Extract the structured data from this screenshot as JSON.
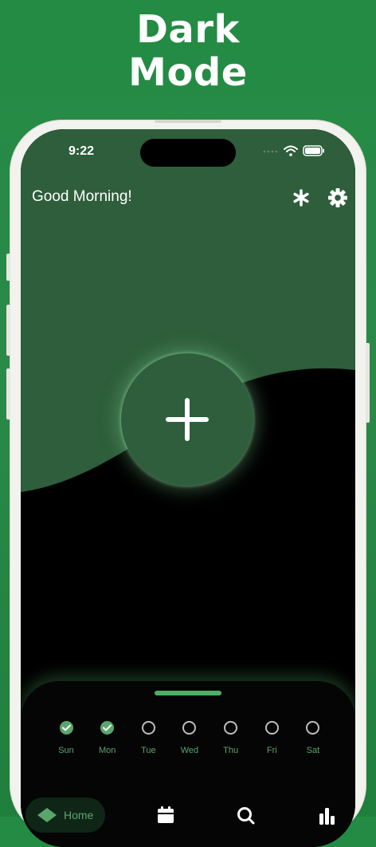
{
  "banner": {
    "line1": "Dark",
    "line2": "Mode"
  },
  "status_bar": {
    "time": "9:22"
  },
  "header": {
    "greeting": "Good Morning!"
  },
  "colors": {
    "background_green": "#238b43",
    "screen_green": "#2e5e3b",
    "accent": "#5aa56c",
    "dark": "#000000"
  },
  "week": [
    {
      "label": "Sun",
      "done": true
    },
    {
      "label": "Mon",
      "done": true
    },
    {
      "label": "Tue",
      "done": false
    },
    {
      "label": "Wed",
      "done": false
    },
    {
      "label": "Thu",
      "done": false
    },
    {
      "label": "Fri",
      "done": false
    },
    {
      "label": "Sat",
      "done": false
    }
  ],
  "tabbar": {
    "home_label": "Home",
    "icons": [
      "home-icon",
      "calendar-icon",
      "search-icon",
      "stats-icon"
    ]
  }
}
